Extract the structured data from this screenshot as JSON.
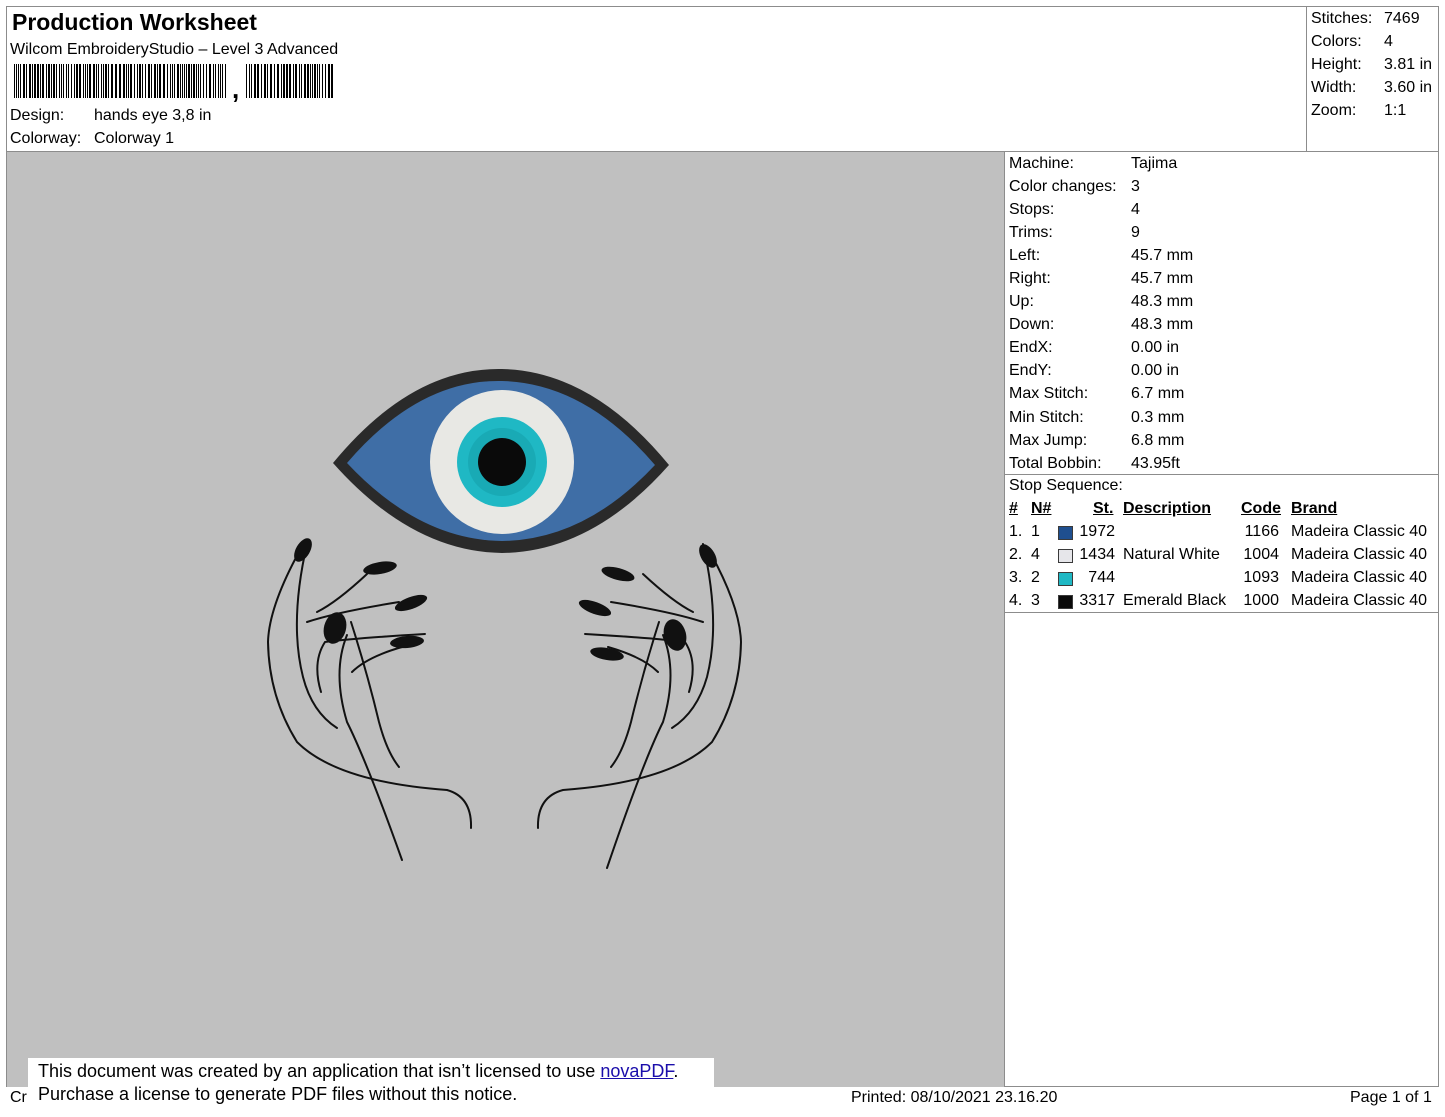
{
  "header": {
    "title": "Production Worksheet",
    "software": "Wilcom EmbroideryStudio – Level 3 Advanced",
    "barcode_comma": ",",
    "design_label": "Design:",
    "design_value": "hands eye 3,8 in",
    "colorway_label": "Colorway:",
    "colorway_value": "Colorway 1"
  },
  "stats": [
    {
      "label": "Stitches:",
      "value": "7469"
    },
    {
      "label": "Colors:",
      "value": "4"
    },
    {
      "label": "Height:",
      "value": "3.81 in"
    },
    {
      "label": "Width:",
      "value": "3.60 in"
    },
    {
      "label": "Zoom:",
      "value": "1:1"
    }
  ],
  "machine_info": [
    {
      "label": "Machine:",
      "value": "Tajima"
    },
    {
      "label": "Color changes:",
      "value": "3"
    },
    {
      "label": "Stops:",
      "value": "4"
    },
    {
      "label": "Trims:",
      "value": "9"
    },
    {
      "label": "Left:",
      "value": "45.7 mm"
    },
    {
      "label": "Right:",
      "value": "45.7 mm"
    },
    {
      "label": "Up:",
      "value": "48.3 mm"
    },
    {
      "label": "Down:",
      "value": "48.3 mm"
    },
    {
      "label": "EndX:",
      "value": "0.00 in"
    },
    {
      "label": "EndY:",
      "value": "0.00 in"
    },
    {
      "label": "Max Stitch:",
      "value": "6.7 mm"
    },
    {
      "label": "Min Stitch:",
      "value": "0.3 mm"
    },
    {
      "label": "Max Jump:",
      "value": "6.8 mm"
    },
    {
      "label": "Total Bobbin:",
      "value": "43.95ft"
    }
  ],
  "stop_sequence": {
    "title": "Stop Sequence:",
    "headers": {
      "num": "#",
      "n": "N#",
      "st": "St.",
      "description": "Description",
      "code": "Code",
      "brand": "Brand"
    },
    "rows": [
      {
        "num": "1.",
        "n": "1",
        "color": "#1f4f8f",
        "st": "1972",
        "description": "",
        "code": "1166",
        "brand": "Madeira Classic 40"
      },
      {
        "num": "2.",
        "n": "4",
        "color": "#e6e6ea",
        "st": "1434",
        "description": "Natural White",
        "code": "1004",
        "brand": "Madeira Classic 40"
      },
      {
        "num": "3.",
        "n": "2",
        "color": "#1fb8c4",
        "st": "744",
        "description": "",
        "code": "1093",
        "brand": "Madeira Classic 40"
      },
      {
        "num": "4.",
        "n": "3",
        "color": "#0a0a0a",
        "st": "3317",
        "description": "Emerald Black",
        "code": "1000",
        "brand": "Madeira Classic 40"
      }
    ]
  },
  "footer": {
    "cut_text": "Cr",
    "printed": "Printed: 08/10/2021 23.16.20",
    "page": "Page 1 of 1"
  },
  "notice": {
    "line1_before": "This document was created by an application that isn’t licensed to use ",
    "link": "novaPDF",
    "line1_after": ".",
    "line2": "Purchase a license to generate PDF files without this notice."
  },
  "colors": {
    "design_background": "#c0c0c0",
    "eye_blue": "#3f6ea6",
    "eye_outline": "#2a2a2a",
    "iris_white": "#e8e8e4",
    "iris_turquoise": "#1fb8c4",
    "pupil": "#0a0a0a",
    "hand_lines": "#111111"
  }
}
